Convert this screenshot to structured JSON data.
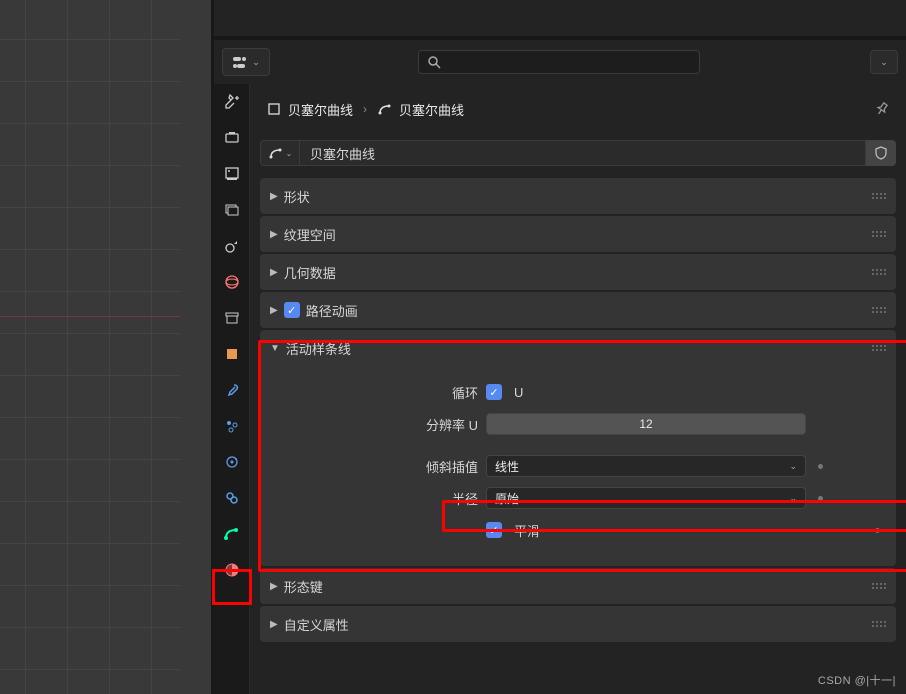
{
  "breadcrumb": {
    "obj": "贝塞尔曲线",
    "data": "贝塞尔曲线"
  },
  "datablock": {
    "name": "贝塞尔曲线"
  },
  "panels": {
    "shape": "形状",
    "tex_space": "纹理空间",
    "geometry": "几何数据",
    "path_anim": "路径动画",
    "active_spline": "活动样条线",
    "shape_keys": "形态键",
    "custom_props": "自定义属性"
  },
  "spline": {
    "cyclic_label": "循环",
    "cyclic_value": "U",
    "resolution_label": "分辨率 U",
    "resolution_value": "12",
    "tilt_label": "倾斜插值",
    "tilt_value": "线性",
    "radius_label": "半径",
    "radius_value": "原始",
    "smooth_label": "平滑"
  },
  "watermark": "CSDN @|十一|"
}
